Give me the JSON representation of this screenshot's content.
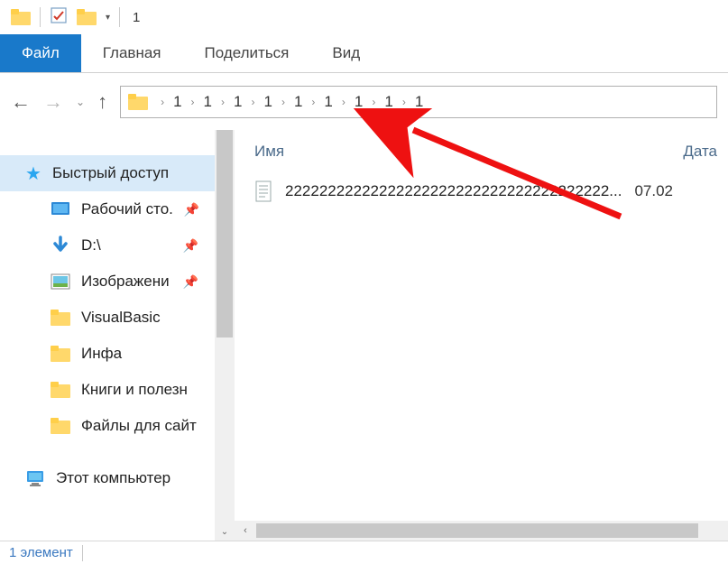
{
  "titlebar": {
    "title": "1"
  },
  "ribbon": {
    "tabs": [
      {
        "label": "Файл",
        "active": true
      },
      {
        "label": "Главная",
        "active": false
      },
      {
        "label": "Поделиться",
        "active": false
      },
      {
        "label": "Вид",
        "active": false
      }
    ]
  },
  "breadcrumb": {
    "segments": [
      "1",
      "1",
      "1",
      "1",
      "1",
      "1",
      "1",
      "1",
      "1"
    ]
  },
  "sidebar": {
    "items": [
      {
        "label": "Быстрый доступ",
        "icon": "star",
        "selected": true,
        "pinned": false,
        "indent": false
      },
      {
        "label": "Рабочий сто.",
        "icon": "desktop",
        "selected": false,
        "pinned": true,
        "indent": true
      },
      {
        "label": "D:\\",
        "icon": "bluearrow",
        "selected": false,
        "pinned": true,
        "indent": true
      },
      {
        "label": "Изображени",
        "icon": "pictures",
        "selected": false,
        "pinned": true,
        "indent": true
      },
      {
        "label": "VisualBasic",
        "icon": "folder",
        "selected": false,
        "pinned": false,
        "indent": true
      },
      {
        "label": "Инфа",
        "icon": "folder",
        "selected": false,
        "pinned": false,
        "indent": true
      },
      {
        "label": "Книги и полезн",
        "icon": "folder",
        "selected": false,
        "pinned": false,
        "indent": true
      },
      {
        "label": "Файлы для сайт",
        "icon": "folder",
        "selected": false,
        "pinned": false,
        "indent": true
      },
      {
        "label": "__spacer__",
        "icon": "",
        "selected": false,
        "pinned": false,
        "indent": false
      },
      {
        "label": "Этот компьютер",
        "icon": "pc",
        "selected": false,
        "pinned": false,
        "indent": false
      }
    ]
  },
  "columns": {
    "name": "Имя",
    "date": "Дата"
  },
  "files": [
    {
      "name": "22222222222222222222222222222222222222...",
      "date": "07.02"
    }
  ],
  "statusbar": {
    "count_text": "1 элемент"
  }
}
